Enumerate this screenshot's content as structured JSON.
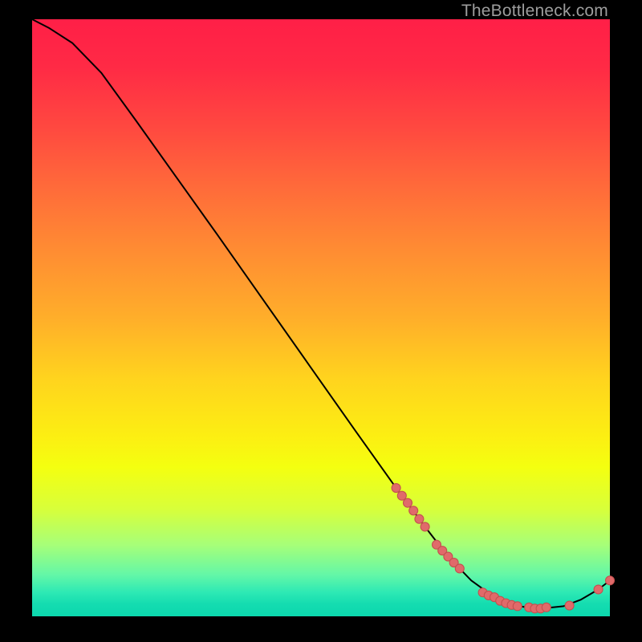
{
  "watermark": "TheBottleneck.com",
  "colors": {
    "background": "#000000",
    "curve": "#000000",
    "dot_fill": "#e06a6a",
    "dot_stroke": "#c4504f"
  },
  "chart_data": {
    "type": "line",
    "title": "",
    "xlabel": "",
    "ylabel": "",
    "xlim": [
      0,
      100
    ],
    "ylim": [
      0,
      100
    ],
    "grid": false,
    "legend": false,
    "annotations": [
      "TheBottleneck.com"
    ],
    "curve": [
      {
        "x": 0,
        "y": 100.0
      },
      {
        "x": 3,
        "y": 98.5
      },
      {
        "x": 7,
        "y": 96.0
      },
      {
        "x": 12,
        "y": 91.0
      },
      {
        "x": 18,
        "y": 83.0
      },
      {
        "x": 25,
        "y": 73.5
      },
      {
        "x": 32,
        "y": 64.0
      },
      {
        "x": 40,
        "y": 53.0
      },
      {
        "x": 48,
        "y": 42.0
      },
      {
        "x": 56,
        "y": 31.0
      },
      {
        "x": 63,
        "y": 21.5
      },
      {
        "x": 68,
        "y": 15.0
      },
      {
        "x": 72,
        "y": 10.0
      },
      {
        "x": 76,
        "y": 6.0
      },
      {
        "x": 80,
        "y": 3.2
      },
      {
        "x": 84,
        "y": 1.7
      },
      {
        "x": 88,
        "y": 1.3
      },
      {
        "x": 92,
        "y": 1.7
      },
      {
        "x": 95,
        "y": 2.8
      },
      {
        "x": 98,
        "y": 4.5
      },
      {
        "x": 100,
        "y": 6.0
      }
    ],
    "series": [
      {
        "name": "markers",
        "points": [
          {
            "x": 63,
            "y": 21.5
          },
          {
            "x": 64,
            "y": 20.2
          },
          {
            "x": 65,
            "y": 19.0
          },
          {
            "x": 66,
            "y": 17.7
          },
          {
            "x": 67,
            "y": 16.3
          },
          {
            "x": 68,
            "y": 15.0
          },
          {
            "x": 70,
            "y": 12.0
          },
          {
            "x": 71,
            "y": 11.0
          },
          {
            "x": 72,
            "y": 10.0
          },
          {
            "x": 73,
            "y": 9.0
          },
          {
            "x": 74,
            "y": 8.0
          },
          {
            "x": 78,
            "y": 4.0
          },
          {
            "x": 79,
            "y": 3.5
          },
          {
            "x": 80,
            "y": 3.2
          },
          {
            "x": 81,
            "y": 2.6
          },
          {
            "x": 82,
            "y": 2.2
          },
          {
            "x": 83,
            "y": 1.9
          },
          {
            "x": 84,
            "y": 1.7
          },
          {
            "x": 86,
            "y": 1.5
          },
          {
            "x": 87,
            "y": 1.3
          },
          {
            "x": 88,
            "y": 1.3
          },
          {
            "x": 89,
            "y": 1.5
          },
          {
            "x": 93,
            "y": 1.8
          },
          {
            "x": 98,
            "y": 4.5
          },
          {
            "x": 100,
            "y": 6.0
          }
        ]
      }
    ]
  }
}
